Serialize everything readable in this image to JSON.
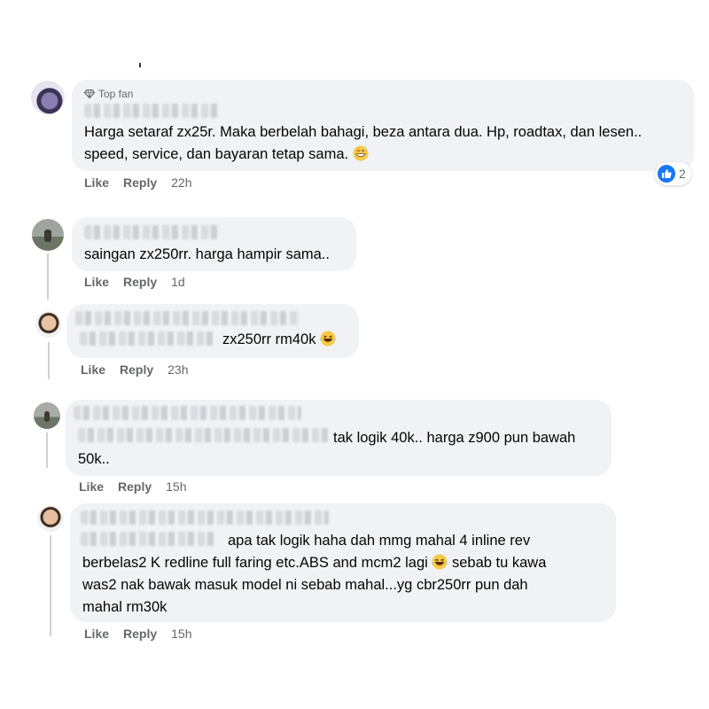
{
  "comments": [
    {
      "badge": "Top fan",
      "lines": [
        "Harga setaraf zx25r. Maka berbelah bahagi, beza antara dua. Hp, roadtax, dan lesen..",
        "speed, service, dan bayaran tetap sama."
      ],
      "emoji": "grinning-sweat-emoji",
      "actions": {
        "like": "Like",
        "reply": "Reply",
        "time": "22h"
      },
      "reaction": {
        "icon": "like-icon",
        "count": "2"
      }
    },
    {
      "lines": [
        "saingan zx250rr. harga hampir sama.."
      ],
      "actions": {
        "like": "Like",
        "reply": "Reply",
        "time": "1d"
      }
    },
    {
      "lines": [
        "zx250rr rm40k"
      ],
      "emoji": "laughing-tears-emoji",
      "actions": {
        "like": "Like",
        "reply": "Reply",
        "time": "23h"
      }
    },
    {
      "lines": [
        "tak logik 40k.. harga z900 pun bawah",
        "50k.."
      ],
      "actions": {
        "like": "Like",
        "reply": "Reply",
        "time": "15h"
      }
    },
    {
      "lines": [
        "apa tak logik haha dah mmg mahal 4 inline rev",
        "berbelas2 K redline full faring etc.ABS and mcm2 lagi",
        "sebab tu kawa",
        "was2 nak bawak masuk model ni sebab mahal...yg cbr250rr pun dah",
        "mahal rm30k"
      ],
      "emoji": "laughing-tears-emoji",
      "actions": {
        "like": "Like",
        "reply": "Reply",
        "time": "15h"
      }
    }
  ]
}
